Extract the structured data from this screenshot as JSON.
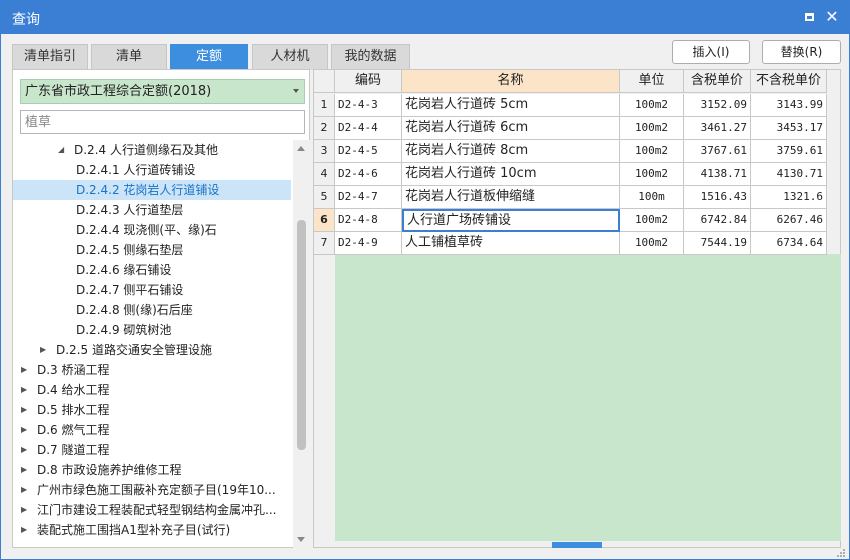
{
  "window": {
    "title": "查询",
    "maximize_icon": "maximize-icon",
    "close_icon": "close-icon"
  },
  "tabs": [
    {
      "label": "清单指引"
    },
    {
      "label": "清单"
    },
    {
      "label": "定额",
      "active": true
    },
    {
      "label": "人材机"
    },
    {
      "label": "我的数据"
    }
  ],
  "toolbar": {
    "insert_label": "插入(I)",
    "replace_label": "替换(R)"
  },
  "left": {
    "quota_library": "广东省市政工程综合定额(2018)",
    "search_placeholder": "植草",
    "tree": [
      {
        "label": "D.2.4 人行道侧缘石及其他",
        "twisty": "expanded"
      },
      {
        "label": "D.2.4.1 人行道砖铺设"
      },
      {
        "label": "D.2.4.2 花岗岩人行道铺设",
        "selected": true
      },
      {
        "label": "D.2.4.3 人行道垫层"
      },
      {
        "label": "D.2.4.4 现浇侧(平、缘)石"
      },
      {
        "label": "D.2.4.5 侧缘石垫层"
      },
      {
        "label": "D.2.4.6 缘石铺设"
      },
      {
        "label": "D.2.4.7 侧平石铺设"
      },
      {
        "label": "D.2.4.8 侧(缘)石后座"
      },
      {
        "label": "D.2.4.9 砌筑树池"
      },
      {
        "label": "D.2.5 道路交通安全管理设施",
        "twisty": "collapsed"
      },
      {
        "label": "D.3 桥涵工程",
        "twisty": "collapsed"
      },
      {
        "label": "D.4 给水工程",
        "twisty": "collapsed"
      },
      {
        "label": "D.5 排水工程",
        "twisty": "collapsed"
      },
      {
        "label": "D.6 燃气工程",
        "twisty": "collapsed"
      },
      {
        "label": "D.7 隧道工程",
        "twisty": "collapsed"
      },
      {
        "label": "D.8 市政设施养护维修工程",
        "twisty": "collapsed"
      },
      {
        "label": "广州市绿色施工围蔽补充定额子目(19年10...",
        "twisty": "collapsed"
      },
      {
        "label": "江门市建设工程装配式轻型钢结构金属冲孔...",
        "twisty": "collapsed"
      },
      {
        "label": "装配式施工围挡A1型补充子目(试行)",
        "twisty": "collapsed"
      }
    ]
  },
  "grid": {
    "columns": [
      "编码",
      "名称",
      "单位",
      "含税单价",
      "不含税单价"
    ],
    "current_row": 6,
    "rows": [
      {
        "index": "1",
        "code": "D2-4-3",
        "name": "花岗岩人行道砖 5cm",
        "unit": "100m2",
        "price_tax": "3152.09",
        "price_notax": "3143.99"
      },
      {
        "index": "2",
        "code": "D2-4-4",
        "name": "花岗岩人行道砖 6cm",
        "unit": "100m2",
        "price_tax": "3461.27",
        "price_notax": "3453.17"
      },
      {
        "index": "3",
        "code": "D2-4-5",
        "name": "花岗岩人行道砖 8cm",
        "unit": "100m2",
        "price_tax": "3767.61",
        "price_notax": "3759.61"
      },
      {
        "index": "4",
        "code": "D2-4-6",
        "name": "花岗岩人行道砖 10cm",
        "unit": "100m2",
        "price_tax": "4138.71",
        "price_notax": "4130.71"
      },
      {
        "index": "5",
        "code": "D2-4-7",
        "name": "花岗岩人行道板伸缩缝",
        "unit": "100m",
        "price_tax": "1516.43",
        "price_notax": "1321.6"
      },
      {
        "index": "6",
        "code": "D2-4-8",
        "name": "人行道广场砖铺设",
        "unit": "100m2",
        "price_tax": "6742.84",
        "price_notax": "6267.46"
      },
      {
        "index": "7",
        "code": "D2-4-9",
        "name": "人工铺植草砖",
        "unit": "100m2",
        "price_tax": "7544.19",
        "price_notax": "6734.64"
      }
    ]
  },
  "colors": {
    "titlebar": "#3a7fd4",
    "active_tab": "#3e8ee0",
    "select_bg": "#c8e6cc",
    "header_highlight": "#fce4c8"
  }
}
